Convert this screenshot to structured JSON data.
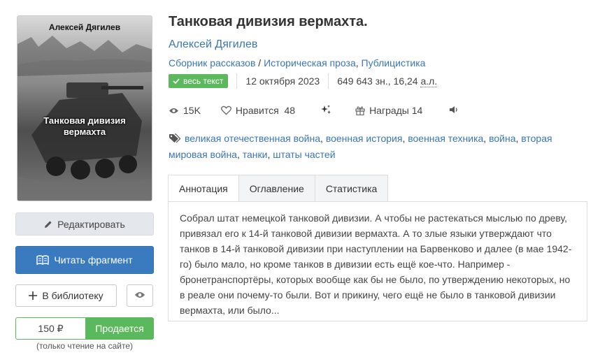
{
  "cover": {
    "author": "Алексей Дягилев",
    "title": "Танковая дивизия вермахта"
  },
  "book": {
    "title": "Танковая дивизия вермахта.",
    "author": "Алексей Дягилев",
    "genres": [
      "Сборник рассказов",
      "Историческая проза",
      "Публицистика"
    ],
    "badge": "весь текст",
    "date": "12 октября 2023",
    "size_chars": "649 643 зн., 16,24",
    "size_unit": "а.л."
  },
  "stats": {
    "views": "15K",
    "likes_label": "Нравится",
    "likes": "48",
    "awards_label": "Награды",
    "awards": "14"
  },
  "tags": [
    "великая отечественная война",
    "военная история",
    "военная техника",
    "война",
    "вторая мировая война",
    "танки",
    "штаты частей"
  ],
  "tabs": {
    "annotation": "Аннотация",
    "contents": "Оглавление",
    "statistics": "Статистика"
  },
  "annotation": "Собрал штат немецкой танковой дивизии. А чтобы не растекаться мыслью по древу, привязал его к 14-й танковой дивизии вермахта. А то злые языки утверждают что танков в 14-й танковой дивизии при наступлении на Барвенково и далее (в мае 1942-го) было мало, но кроме танков в дивизии есть ещё кое-что. Например - бронетранспортёры, которых вообще как бы не было, по утверждению некоторых, но в реале они почему-то были. Вот и прикину, чего ещё не было в танковой дивизии вермахта, или было...",
  "buttons": {
    "edit": "Редактировать",
    "read": "Читать фрагмент",
    "library": "В библиотеку",
    "price": "150 ₽",
    "sale": "Продается",
    "price_note": "(только чтение на сайте)"
  },
  "colors": {
    "link": "#3a76b5",
    "primary": "#3a7bbf",
    "success": "#5cb85c"
  }
}
